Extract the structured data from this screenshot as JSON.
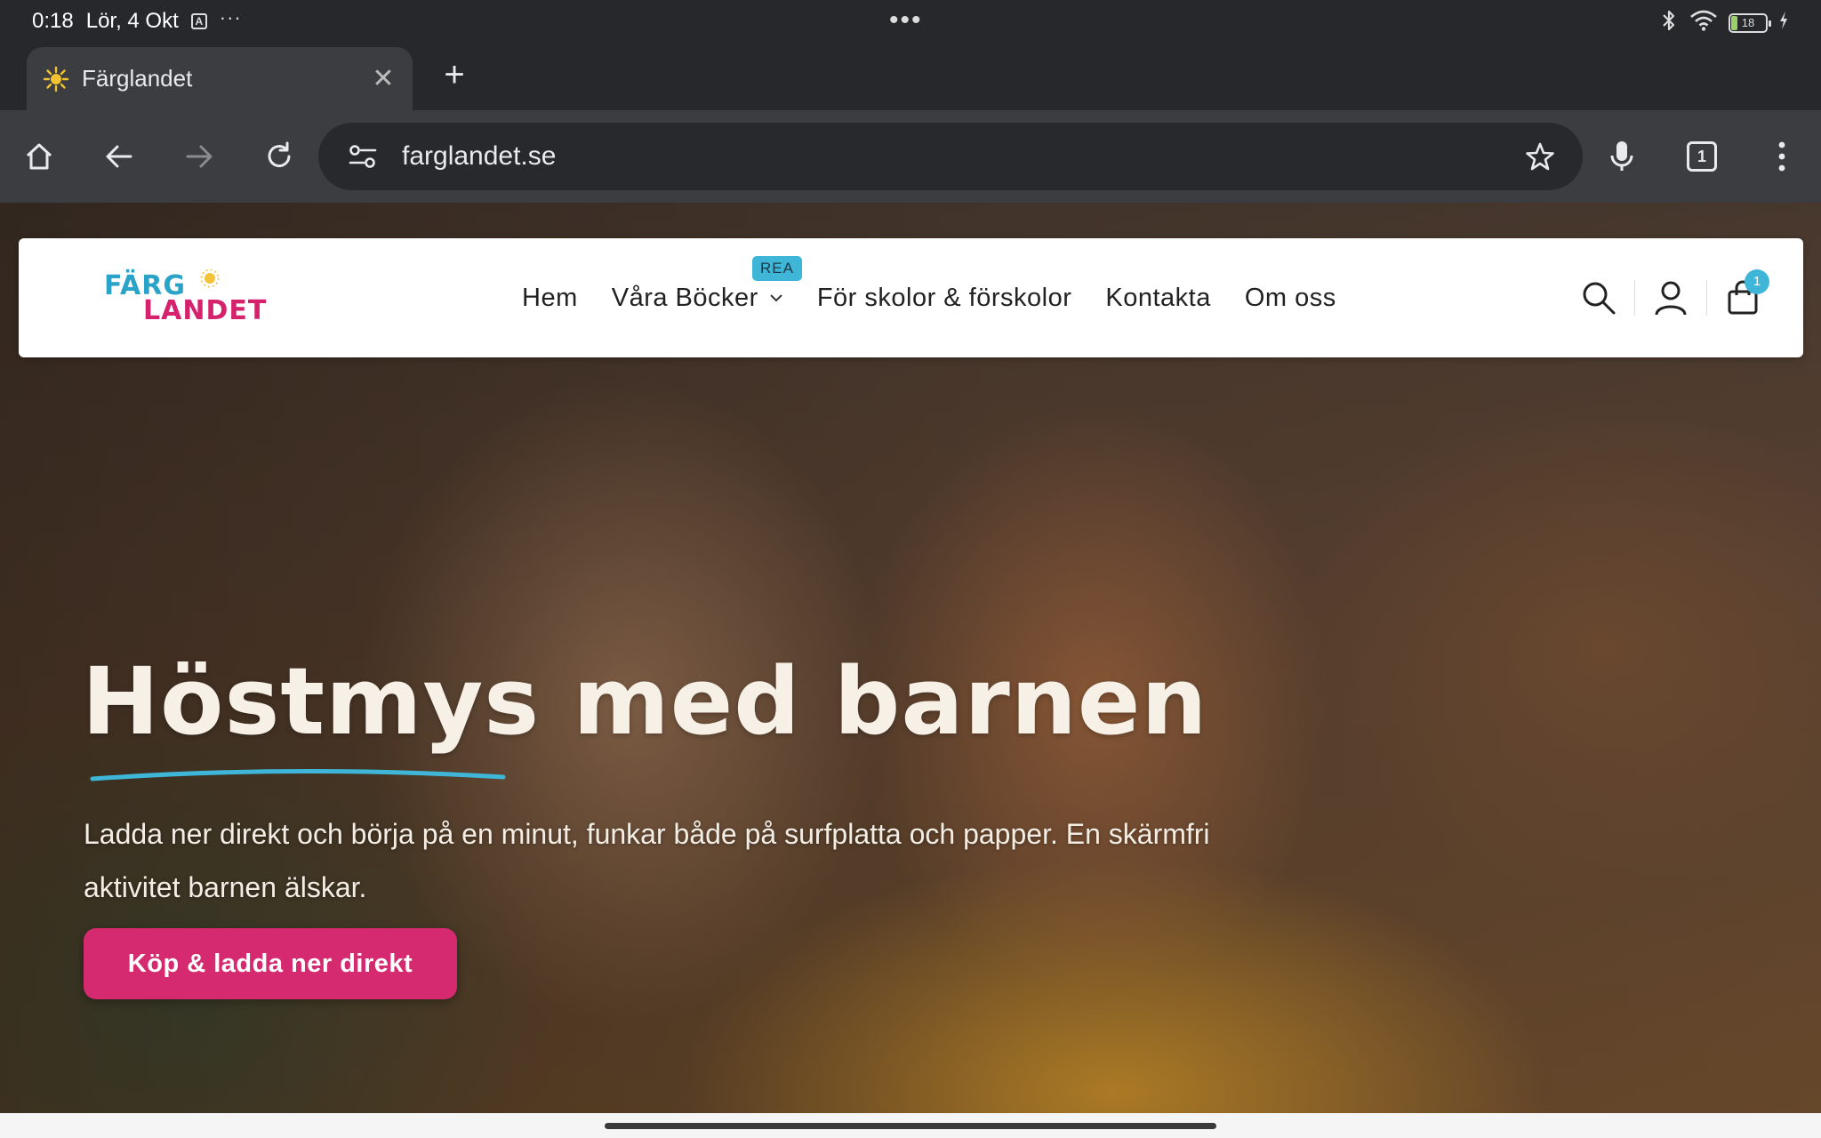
{
  "status_bar": {
    "time": "0:18",
    "date": "Lör, 4 Okt",
    "notification_icon_label": "A",
    "more_dots": "···",
    "center_dots": "•••",
    "battery_level": "18"
  },
  "browser": {
    "tab": {
      "title": "Färglandet",
      "close_glyph": "✕"
    },
    "new_tab_glyph": "+",
    "url": "farglandet.se",
    "tab_count": "1"
  },
  "site": {
    "logo": {
      "line1": "FÄRG",
      "line2": "LANDET"
    },
    "nav": {
      "items": [
        {
          "label": "Hem"
        },
        {
          "label": "Våra Böcker",
          "badge": "REA",
          "has_dropdown": true
        },
        {
          "label": "För skolor & förskolor"
        },
        {
          "label": "Kontakta"
        },
        {
          "label": "Om oss"
        }
      ],
      "cart_count": "1"
    },
    "hero": {
      "title": "Höstmys med barnen",
      "text": "Ladda ner direkt och börja på en minut, funkar både på surfplatta och papper. En skärmfri aktivitet barnen älskar.",
      "cta": "Köp & ladda ner direkt"
    }
  },
  "colors": {
    "brand_pink": "#d62a70",
    "brand_blue": "#3fb6d8",
    "browser_dark": "#27282b",
    "toolbar": "#3c3d40"
  }
}
